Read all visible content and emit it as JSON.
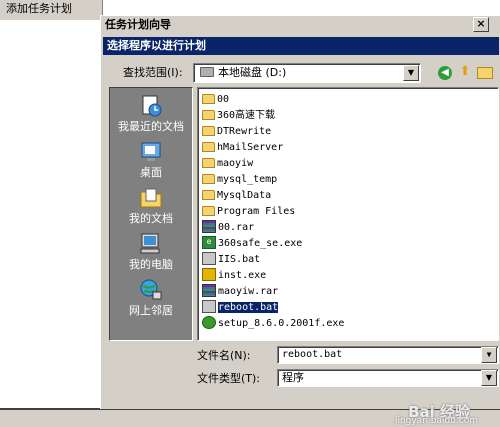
{
  "background_window": {
    "title": "添加任务计划"
  },
  "dialog": {
    "title": "任务计划向导",
    "close_label": "×",
    "subtitle": "选择程序以进行计划",
    "look_in": {
      "label": "查找范围(I):",
      "value": "本地磁盘 (D:)",
      "icon": "drive-icon"
    },
    "toolbar": {
      "back_icon": "back-icon",
      "up_icon": "up-folder-icon",
      "new_folder_icon": "new-folder-icon"
    },
    "places": [
      {
        "label": "我最近的文档",
        "icon": "recent-documents-icon"
      },
      {
        "label": "桌面",
        "icon": "desktop-icon"
      },
      {
        "label": "我的文档",
        "icon": "my-documents-icon"
      },
      {
        "label": "我的电脑",
        "icon": "my-computer-icon"
      },
      {
        "label": "网上邻居",
        "icon": "network-icon"
      }
    ],
    "files": [
      {
        "name": "00",
        "type": "folder"
      },
      {
        "name": "360高速下载",
        "type": "folder"
      },
      {
        "name": "DTRewrite",
        "type": "folder"
      },
      {
        "name": "hMailServer",
        "type": "folder"
      },
      {
        "name": "maoyiw",
        "type": "folder"
      },
      {
        "name": "mysql_temp",
        "type": "folder"
      },
      {
        "name": "MysqlData",
        "type": "folder"
      },
      {
        "name": "Program Files",
        "type": "folder"
      },
      {
        "name": "00.rar",
        "type": "rar"
      },
      {
        "name": "360safe_se.exe",
        "type": "exe"
      },
      {
        "name": "IIS.bat",
        "type": "bat"
      },
      {
        "name": "inst.exe",
        "type": "inst"
      },
      {
        "name": "maoyiw.rar",
        "type": "rar"
      },
      {
        "name": "reboot.bat",
        "type": "bat",
        "selected": true
      },
      {
        "name": "setup_8.6.0.2001f.exe",
        "type": "setup"
      }
    ],
    "file_name": {
      "label": "文件名(N):",
      "value": "reboot.bat"
    },
    "file_type": {
      "label": "文件类型(T):",
      "value": "程序"
    }
  },
  "watermark": {
    "text": "Bai 经验",
    "sub": "jingyan.baidu.com"
  }
}
